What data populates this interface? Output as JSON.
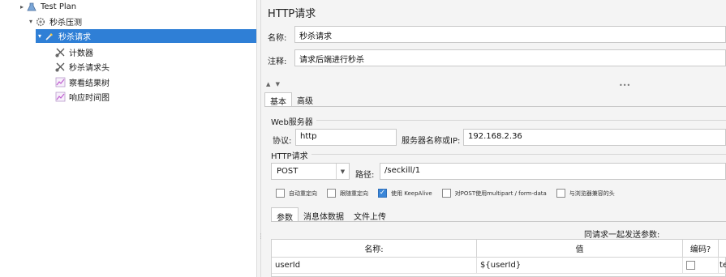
{
  "tree": {
    "items": [
      {
        "label": "Test Plan",
        "icon": "test-plan-icon",
        "toggle": "▸",
        "indent": 0,
        "selected": false
      },
      {
        "label": "秒杀压测",
        "icon": "thread-group-gear-icon",
        "toggle": "▾",
        "indent": 1,
        "selected": false
      },
      {
        "label": "秒杀请求",
        "icon": "pipette-sampler-icon",
        "toggle": "▾",
        "indent": 2,
        "selected": true
      },
      {
        "label": "计数器",
        "icon": "config-scissors-icon",
        "toggle": "",
        "indent": 3,
        "selected": false
      },
      {
        "label": "秒杀请求头",
        "icon": "config-scissors-icon",
        "toggle": "",
        "indent": 3,
        "selected": false
      },
      {
        "label": "察看结果树",
        "icon": "listener-chart-icon",
        "toggle": "",
        "indent": 3,
        "selected": false
      },
      {
        "label": "响应时间图",
        "icon": "listener-chart-icon",
        "toggle": "",
        "indent": 3,
        "selected": false
      }
    ]
  },
  "panel": {
    "title": "HTTP请求",
    "name_label": "名称:",
    "name_value": "秒杀请求",
    "comment_label": "注释:",
    "comment_value": "请求后端进行秒杀",
    "collapse_arrows": "▲ ▼",
    "dots": "•••",
    "tabs": [
      "基本",
      "高级"
    ],
    "web_server": {
      "group_label": "Web服务器",
      "protocol_label": "协议:",
      "protocol_value": "http",
      "server_label": "服务器名称或IP:",
      "server_value": "192.168.2.36"
    },
    "http_request": {
      "group_label": "HTTP请求",
      "method": "POST",
      "path_label": "路径:",
      "path_value": "/seckill/1"
    },
    "options": [
      {
        "label": "自动重定向",
        "checked": false
      },
      {
        "label": "跟随重定向",
        "checked": false
      },
      {
        "label": "使用 KeepAlive",
        "checked": true
      },
      {
        "label": "对POST使用multipart / form-data",
        "checked": false
      },
      {
        "label": "与浏览器兼容的头",
        "checked": false
      }
    ],
    "subtabs": [
      "参数",
      "消息体数据",
      "文件上传"
    ],
    "table": {
      "caption": "同请求一起发送参数:",
      "headers": [
        "名称:",
        "值",
        "编码?",
        ""
      ],
      "rows": [
        {
          "name": "userId",
          "value": "${userId}",
          "encode": false,
          "extra": "te"
        }
      ]
    }
  },
  "colors": {
    "selection": "#2f7fd6",
    "checkbox_checked": "#3a86d8"
  }
}
